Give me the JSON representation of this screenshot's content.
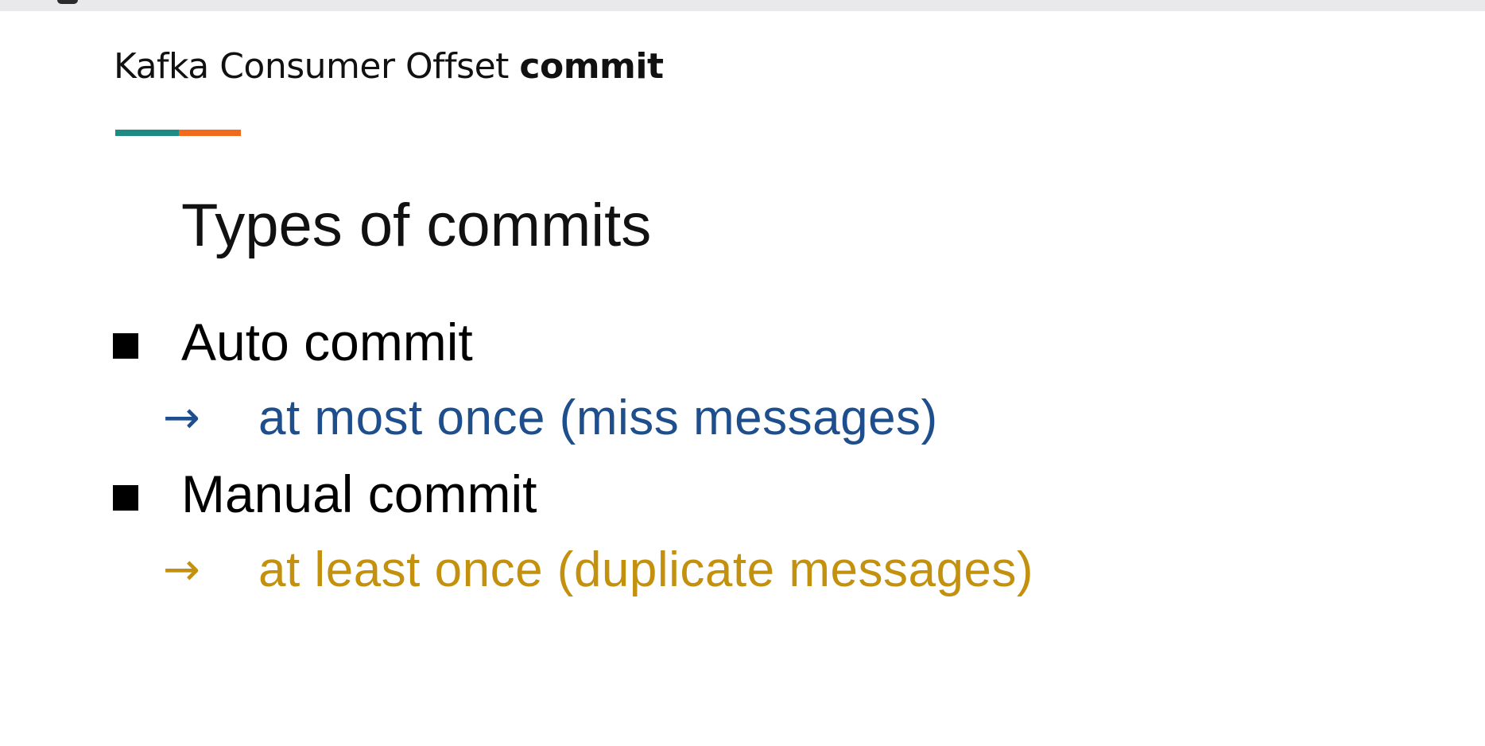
{
  "slide": {
    "title_regular": "Kafka Consumer Offset ",
    "title_bold": "commit",
    "heading": "Types of commits",
    "accent_colors": {
      "teal": "#1e8a84",
      "orange": "#f26a1b"
    }
  },
  "bullets": [
    {
      "label": "Auto commit",
      "arrow": "→",
      "detail": "at most once (miss messages)",
      "detail_color": "#1f4e8c"
    },
    {
      "label": "Manual commit",
      "arrow": "→",
      "detail": "at least once (duplicate messages)",
      "detail_color": "#c4910f"
    }
  ]
}
